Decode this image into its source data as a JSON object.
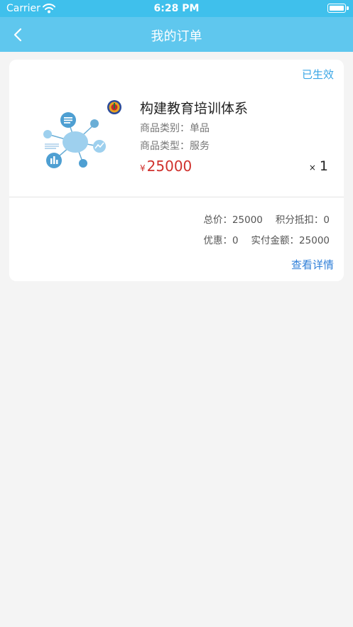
{
  "status_bar": {
    "carrier": "Carrier",
    "time": "6:28 PM"
  },
  "nav": {
    "title": "我的订单",
    "back_icon": "chevron-left-icon"
  },
  "order": {
    "status": "已生效",
    "product_name": "构建教育培训体系",
    "category_label": "商品类别：",
    "category_value": "单品",
    "type_label": "商品类型：",
    "type_value": "服务",
    "currency": "¥",
    "price": "25000",
    "qty_prefix": "×",
    "qty": "1",
    "summary": {
      "total_label": "总价：",
      "total_value": "25000",
      "points_label": "积分抵扣：",
      "points_value": "0",
      "discount_label": "优惠：",
      "discount_value": "0",
      "paid_label": "实付金额：",
      "paid_value": "25000"
    },
    "detail_link": "查看详情"
  },
  "colors": {
    "status_bar": "#3fc0ec",
    "nav_bar": "#5fc7ee",
    "price": "#d0312d",
    "link": "#2f7fd8",
    "status": "#3aa6e6"
  }
}
